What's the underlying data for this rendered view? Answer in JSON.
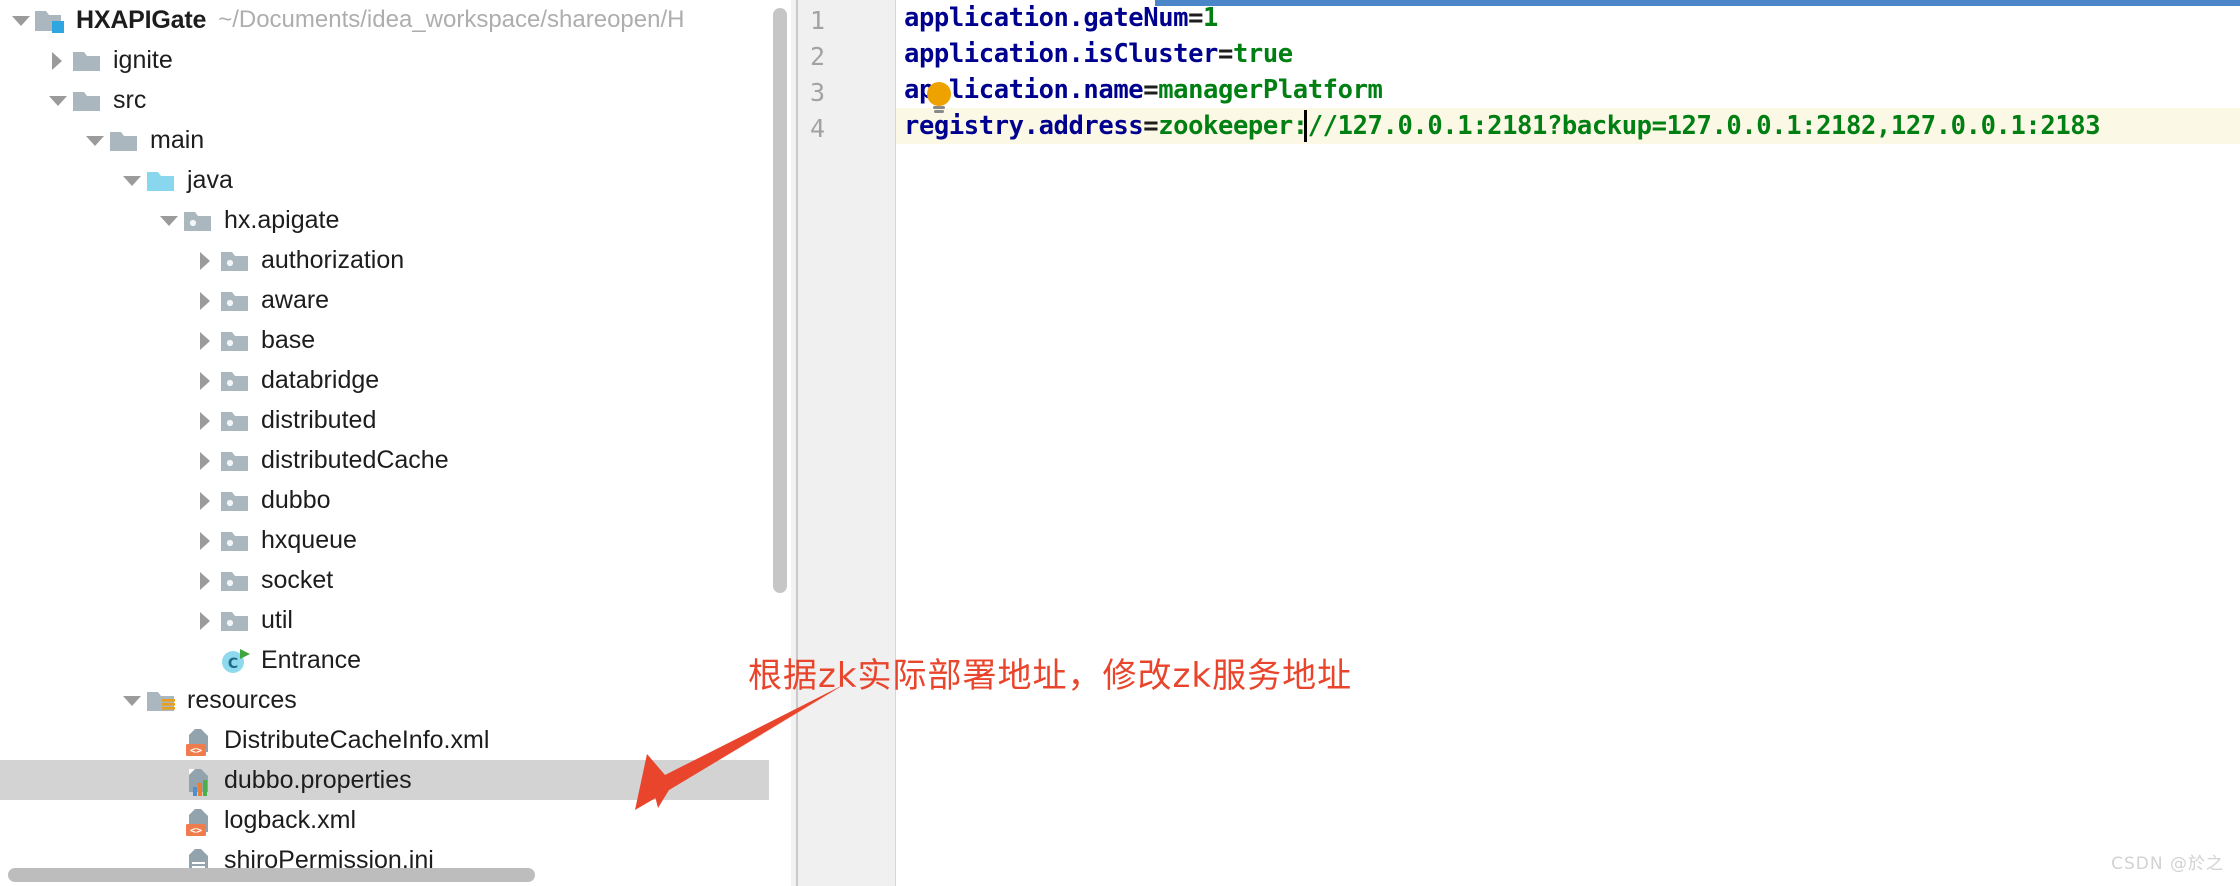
{
  "project_panel": {
    "name": "project-tool-window",
    "scrollbars": {
      "vertical": "vertical-scrollbar",
      "horizontal": "horizontal-scrollbar"
    },
    "tree": [
      {
        "label": "HXAPIGate",
        "path_suffix": "~/Documents/idea_workspace/shareopen/H",
        "icon": "project-module-icon",
        "depth": 0,
        "state": "expanded",
        "selected": false,
        "bold": true
      },
      {
        "label": "ignite",
        "icon": "folder-icon",
        "depth": 1,
        "state": "collapsed",
        "selected": false,
        "bold": false
      },
      {
        "label": "src",
        "icon": "folder-icon",
        "depth": 1,
        "state": "expanded",
        "selected": false,
        "bold": false
      },
      {
        "label": "main",
        "icon": "folder-icon",
        "depth": 2,
        "state": "expanded",
        "selected": false,
        "bold": false
      },
      {
        "label": "java",
        "icon": "source-root-folder-icon",
        "depth": 3,
        "state": "expanded",
        "selected": false,
        "bold": false
      },
      {
        "label": "hx.apigate",
        "icon": "package-icon",
        "depth": 4,
        "state": "expanded",
        "selected": false,
        "bold": false
      },
      {
        "label": "authorization",
        "icon": "package-icon",
        "depth": 5,
        "state": "collapsed",
        "selected": false,
        "bold": false
      },
      {
        "label": "aware",
        "icon": "package-icon",
        "depth": 5,
        "state": "collapsed",
        "selected": false,
        "bold": false
      },
      {
        "label": "base",
        "icon": "package-icon",
        "depth": 5,
        "state": "collapsed",
        "selected": false,
        "bold": false
      },
      {
        "label": "databridge",
        "icon": "package-icon",
        "depth": 5,
        "state": "collapsed",
        "selected": false,
        "bold": false
      },
      {
        "label": "distributed",
        "icon": "package-icon",
        "depth": 5,
        "state": "collapsed",
        "selected": false,
        "bold": false
      },
      {
        "label": "distributedCache",
        "icon": "package-icon",
        "depth": 5,
        "state": "collapsed",
        "selected": false,
        "bold": false
      },
      {
        "label": "dubbo",
        "icon": "package-icon",
        "depth": 5,
        "state": "collapsed",
        "selected": false,
        "bold": false
      },
      {
        "label": "hxqueue",
        "icon": "package-icon",
        "depth": 5,
        "state": "collapsed",
        "selected": false,
        "bold": false
      },
      {
        "label": "socket",
        "icon": "package-icon",
        "depth": 5,
        "state": "collapsed",
        "selected": false,
        "bold": false
      },
      {
        "label": "util",
        "icon": "package-icon",
        "depth": 5,
        "state": "collapsed",
        "selected": false,
        "bold": false
      },
      {
        "label": "Entrance",
        "icon": "java-class-runnable-icon",
        "depth": 5,
        "state": "leaf",
        "selected": false,
        "bold": false
      },
      {
        "label": "resources",
        "icon": "resources-root-folder-icon",
        "depth": 3,
        "state": "expanded",
        "selected": false,
        "bold": false
      },
      {
        "label": "DistributeCacheInfo.xml",
        "icon": "xml-file-icon",
        "depth": 4,
        "state": "leaf",
        "selected": false,
        "bold": false
      },
      {
        "label": "dubbo.properties",
        "icon": "properties-file-icon",
        "depth": 4,
        "state": "leaf",
        "selected": true,
        "bold": false
      },
      {
        "label": "logback.xml",
        "icon": "xml-file-icon",
        "depth": 4,
        "state": "leaf",
        "selected": false,
        "bold": false
      },
      {
        "label": "shiroPermission.ini",
        "icon": "ini-file-icon",
        "depth": 4,
        "state": "leaf",
        "selected": false,
        "bold": false
      }
    ]
  },
  "editor": {
    "name": "properties-editor",
    "filename": "dubbo.properties",
    "gutter_icon": "intention-bulb-icon",
    "caret_line": 4,
    "lines": [
      {
        "no": "1",
        "key": "application.gateNum",
        "eq": "=",
        "value": "1",
        "highlighted": false
      },
      {
        "no": "2",
        "key": "application.isCluster",
        "eq": "=",
        "value": "true",
        "highlighted": false
      },
      {
        "no": "3",
        "key": "application.name",
        "eq": "=",
        "value": "managerPlatform",
        "highlighted": false
      },
      {
        "no": "4",
        "key": "registry.address",
        "eq": "=",
        "value": "zookeeper://127.0.0.1:2181?backup=127.0.0.1:2182,127.0.0.1:2183",
        "highlighted": true
      }
    ],
    "colors": {
      "key": "#00008f",
      "value": "#007f12",
      "highlight_row": "#fcf8e6",
      "top_marker": "#4a86c8"
    }
  },
  "annotation": {
    "name": "callout-annotation",
    "text": "根据zk实际部署地址，修改zk服务地址",
    "color": "#e8452c",
    "arrow": "arrow-pointing-down-left"
  },
  "watermark": {
    "text": "CSDN @於之"
  }
}
